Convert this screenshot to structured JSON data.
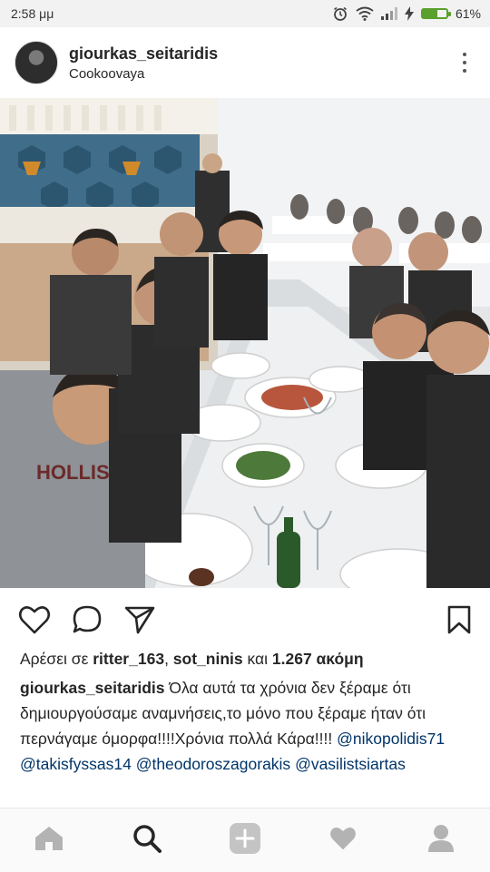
{
  "status_bar": {
    "time": "2:58 μμ",
    "battery_percent": "61%",
    "battery_level": 0.61,
    "icons": [
      "alarm-icon",
      "wifi-icon",
      "signal-icon",
      "charging-icon",
      "battery-icon"
    ]
  },
  "post": {
    "username": "giourkas_seitaridis",
    "location": "Cookoovaya",
    "photo_alt": "",
    "likes": {
      "prefix": "Αρέσει σε ",
      "user1": "ritter_163",
      "sep1": ", ",
      "user2": "sot_ninis",
      "sep2": " και ",
      "count": "1.267 ακόμη"
    },
    "caption": {
      "author": "giourkas_seitaridis",
      "text": " Όλα αυτά τα χρόνια δεν ξέραμε ότι δημιουργούσαμε αναμνήσεις,το μόνο που ξέραμε ήταν ότι περνάγαμε όμορφα!!!!Χρόνια πολλά Κάρα!!!! ",
      "mentions": [
        "@nikopolidis71",
        "@takisfyssas14",
        "@theodoroszagorakis",
        "@vasilistsiartas"
      ]
    }
  },
  "actions": [
    "heart-icon",
    "comment-icon",
    "share-icon",
    "bookmark-icon"
  ],
  "nav": [
    "home-icon",
    "search-icon",
    "add-icon",
    "activity-icon",
    "profile-icon"
  ],
  "colors": {
    "battery": "#5aa02c",
    "mention": "#003569",
    "nav_inactive": "#b3b3b3",
    "nav_active": "#262626"
  }
}
